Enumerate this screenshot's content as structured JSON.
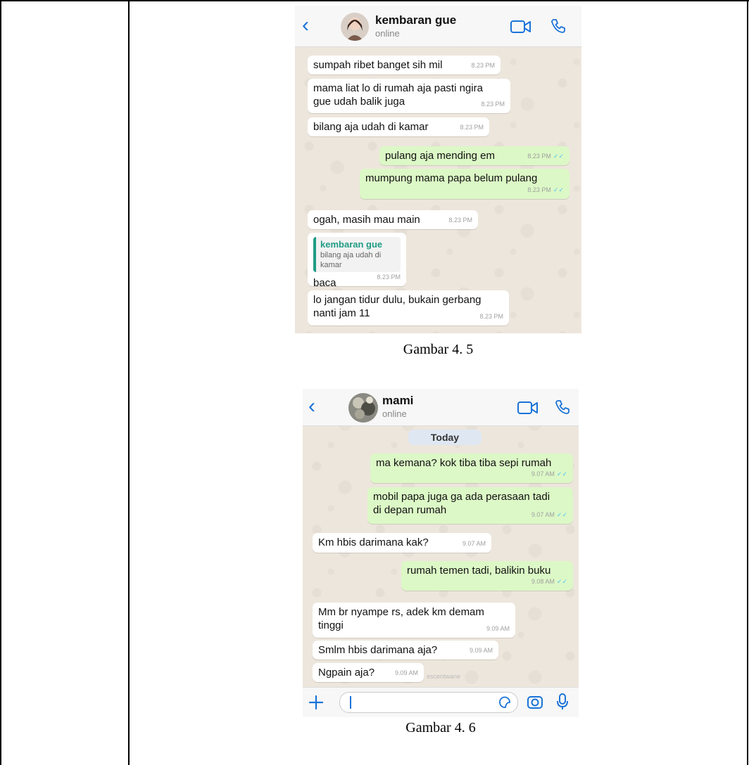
{
  "figures": [
    {
      "caption": "Gambar 4. 5",
      "contact_name": "kembaran gue",
      "contact_status": "online",
      "messages": [
        {
          "dir": "in",
          "lines": [
            "sumpah ribet banget sih mil"
          ],
          "time": "8.23 PM"
        },
        {
          "dir": "in",
          "lines": [
            "mama liat lo di rumah aja pasti ngira",
            "gue udah balik juga"
          ],
          "time": "8.23 PM"
        },
        {
          "dir": "in",
          "lines": [
            "bilang aja udah di kamar"
          ],
          "time": "8.23 PM"
        },
        {
          "dir": "out",
          "lines": [
            "pulang aja mending em"
          ],
          "time": "8.23 PM"
        },
        {
          "dir": "out",
          "lines": [
            "mumpung mama papa belum pulang"
          ],
          "time": "8.23 PM"
        },
        {
          "dir": "in",
          "lines": [
            "ogah, masih mau main"
          ],
          "time": "8.23 PM"
        },
        {
          "dir": "in",
          "quote_name": "kembaran gue",
          "quote_text": "bilang aja udah di kamar",
          "lines": [
            "baca"
          ],
          "time": "8.23 PM"
        },
        {
          "dir": "in",
          "lines": [
            "lo jangan tidur dulu, bukain gerbang",
            "nanti jam 11"
          ],
          "time": "8.23 PM"
        }
      ]
    },
    {
      "caption": "Gambar 4. 6",
      "contact_name": "mami",
      "contact_status": "online",
      "date_chip": "Today",
      "watermark": "escentwane",
      "messages": [
        {
          "dir": "out",
          "lines": [
            "ma kemana? kok tiba tiba sepi rumah"
          ],
          "time": "9.07 AM"
        },
        {
          "dir": "out",
          "lines": [
            "mobil papa juga ga ada perasaan tadi",
            "di depan rumah"
          ],
          "time": "9.07 AM"
        },
        {
          "dir": "in",
          "lines": [
            "Km hbis darimana kak?"
          ],
          "time": "9.07 AM"
        },
        {
          "dir": "out",
          "lines": [
            "rumah temen tadi, balikin buku"
          ],
          "time": "9.08 AM"
        },
        {
          "dir": "in",
          "lines": [
            "Mm br nyampe rs, adek km demam",
            "tinggi"
          ],
          "time": "9.09 AM"
        },
        {
          "dir": "in",
          "lines": [
            "Smlm hbis darimana aja?"
          ],
          "time": "9.09 AM"
        },
        {
          "dir": "in",
          "lines": [
            "Ngpain aja?"
          ],
          "time": "9.09 AM"
        }
      ]
    }
  ],
  "icons": {
    "back": "chevron-left-icon",
    "video": "video-camera-icon",
    "phone": "phone-icon",
    "attach": "plus-icon",
    "sticker": "sticker-icon",
    "camera": "camera-icon",
    "mic": "microphone-icon"
  },
  "colors": {
    "accent_blue": "#1a73d9",
    "outgoing_bubble": "#dcf8c6",
    "incoming_bubble": "#ffffff",
    "chat_background": "#ede6dc",
    "read_ticks": "#4fc3f7",
    "quote_accent": "#1f9c85"
  }
}
